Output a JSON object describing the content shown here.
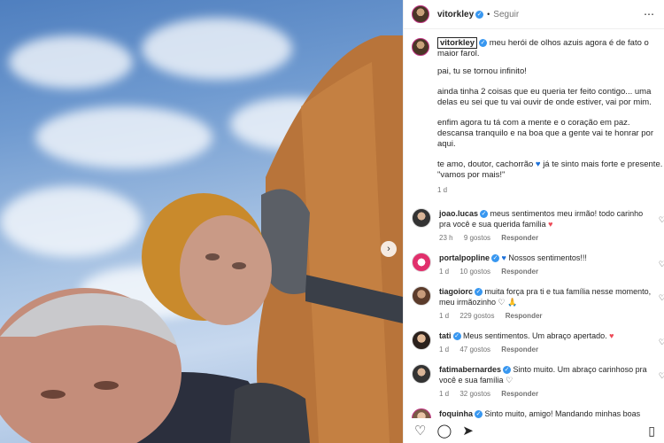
{
  "post": {
    "username": "vitorkley",
    "follow_label": "Seguir",
    "more_icon": "more-options-icon"
  },
  "caption": {
    "username": "vitorkley",
    "line1": "meu herói de olhos azuis agora é de fato o maior farol.",
    "line2": "pai, tu se tornou infinito!",
    "line3": "ainda tinha 2 coisas que eu queria ter feito contigo... uma delas eu sei que tu vai ouvir de onde estiver, vai por mim.",
    "line4": "enfim agora tu tá com a mente e o coração em paz. descansa tranquilo e na boa que a gente vai te honrar por aqui.",
    "line5a": "te amo, doutor, cachorrão",
    "line5b": "já te sinto mais forte e presente. \"vamos por mais!\"",
    "time": "1 d"
  },
  "comments": [
    {
      "user": "joao.lucas",
      "text": "meus sentimentos meu irmão! todo carinho pra você e sua querida família",
      "emoji": "♥",
      "time": "23 h",
      "likes": "9 gostos",
      "reply": "Responder"
    },
    {
      "user": "portalpopline",
      "text": "Nossos sentimentos!!!",
      "emoji_prefix": "♥",
      "time": "1 d",
      "likes": "10 gostos",
      "reply": "Responder"
    },
    {
      "user": "tiagoiorc",
      "text": "muita força pra ti e tua família nesse momento, meu irmãozinho",
      "emoji": "♡ 🙏",
      "time": "1 d",
      "likes": "229 gostos",
      "reply": "Responder"
    },
    {
      "user": "tati",
      "text": "Meus sentimentos. Um abraço apertado.",
      "emoji": "♥",
      "time": "1 d",
      "likes": "47 gostos",
      "reply": "Responder"
    },
    {
      "user": "fatimabernardes",
      "text": "Sinto muito. Um abraço carinhoso pra você e sua família",
      "emoji": "♡",
      "time": "1 d",
      "likes": "32 gostos",
      "reply": "Responder"
    },
    {
      "user": "foquinha",
      "text": "Sinto muito, amigo! Mandando minhas boas",
      "time": "",
      "likes": "",
      "reply": ""
    }
  ],
  "colors": {
    "verified": "#3897f0",
    "heart": "#ed4956",
    "blue_heart": "#1b6fd8"
  }
}
